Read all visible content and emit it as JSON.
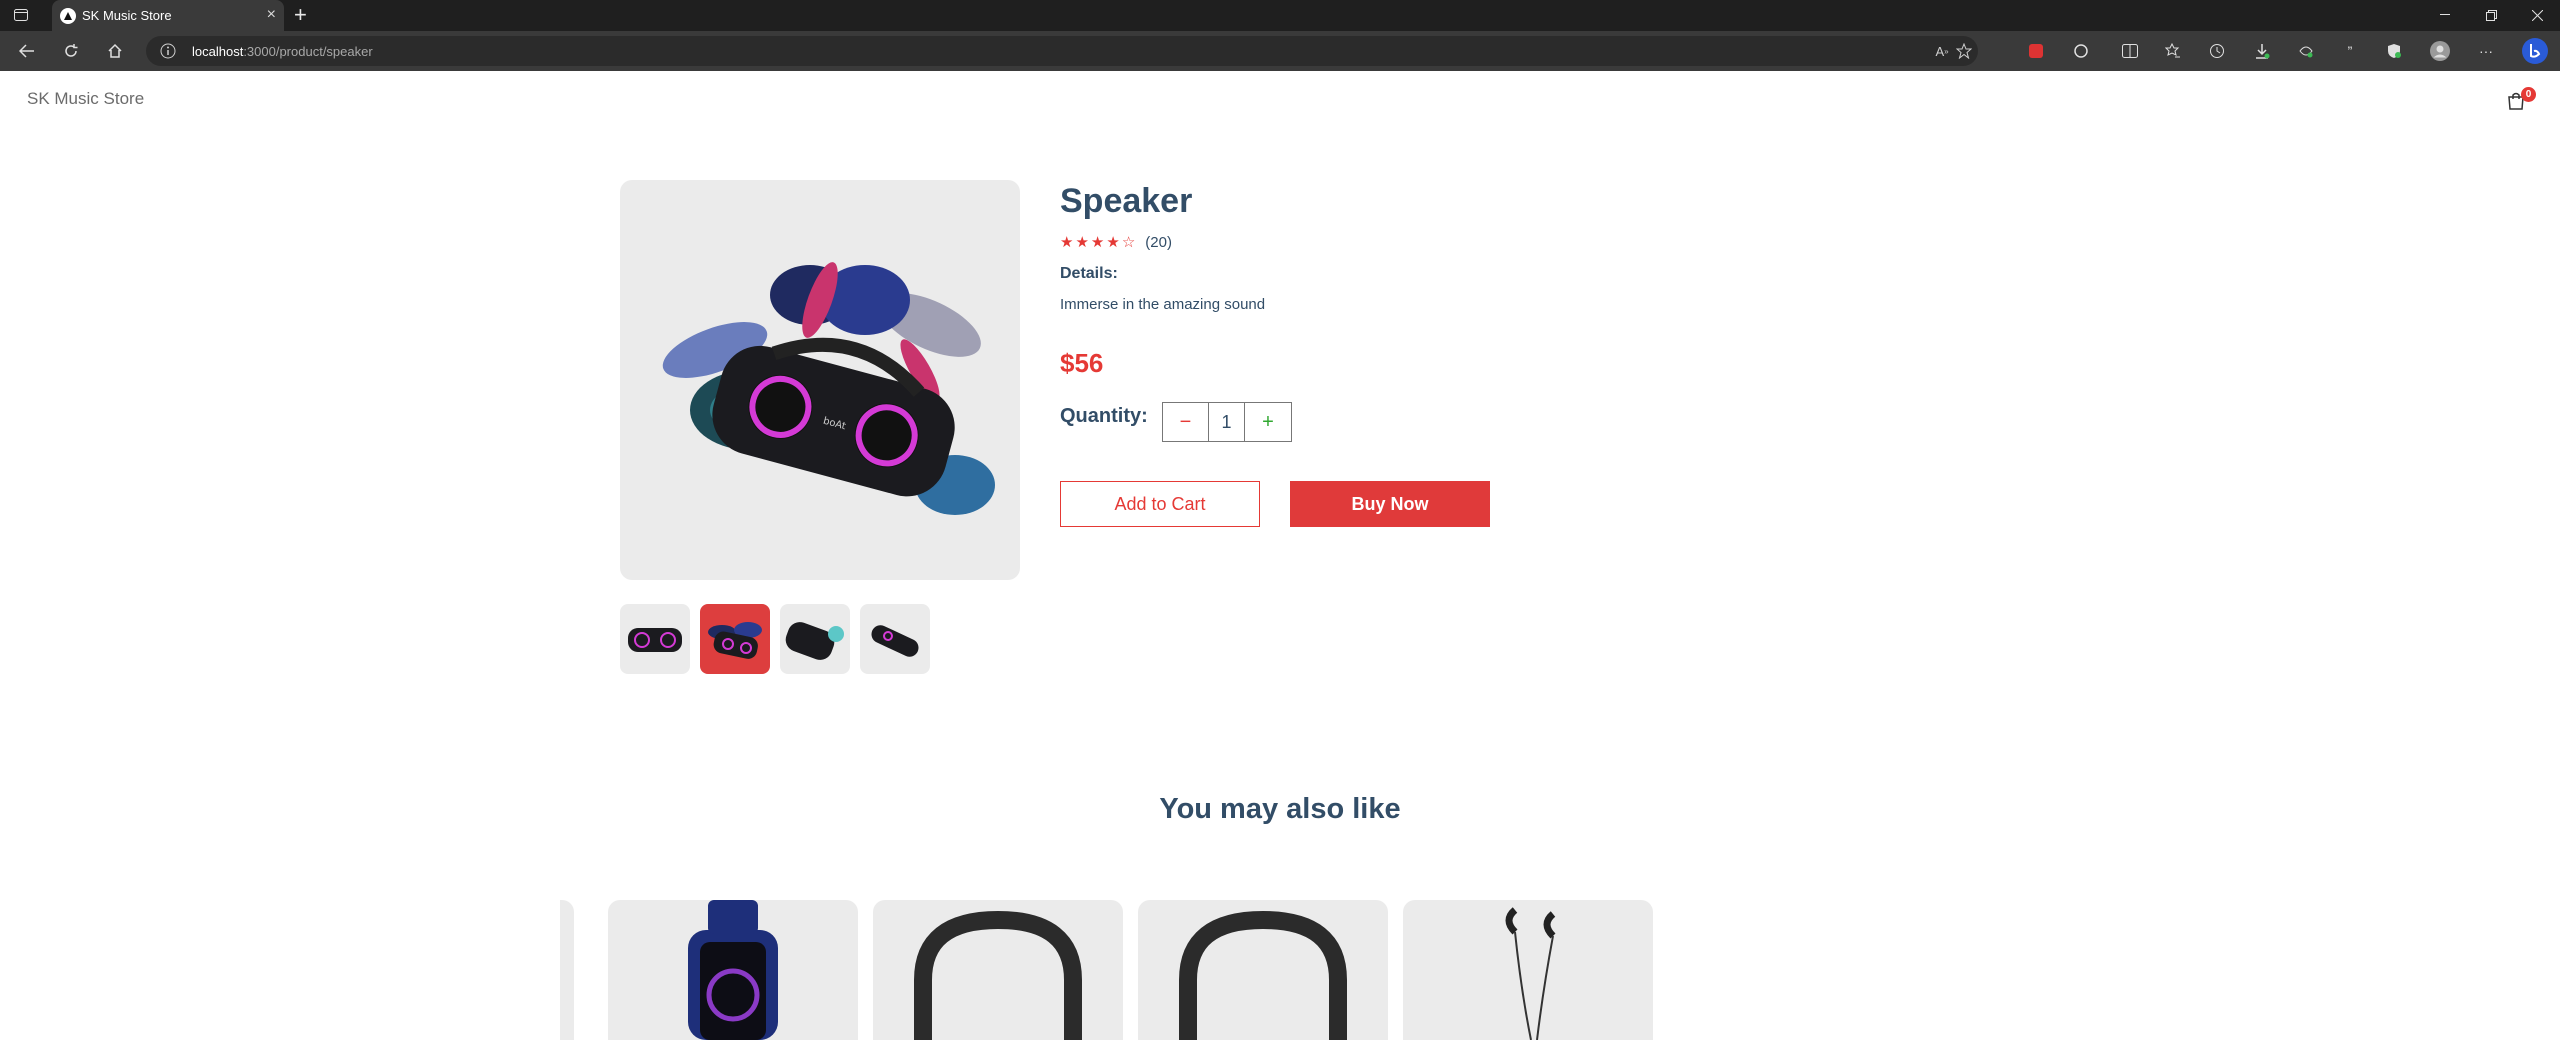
{
  "browser": {
    "tab_title": "SK Music Store",
    "new_tab": "+",
    "close_tab": "×",
    "url_host": "localhost",
    "url_path": ":3000/product/speaker"
  },
  "site": {
    "brand": "SK Music Store",
    "cart_count": "0"
  },
  "product": {
    "title": "Speaker",
    "rating": 4,
    "rating_max": 5,
    "rating_count": "(20)",
    "details_label": "Details:",
    "details_text": "Immerse in the amazing sound",
    "price": "$56",
    "quantity_label": "Quantity:",
    "quantity_minus": "−",
    "quantity_value": "1",
    "quantity_plus": "+",
    "add_to_cart_label": "Add to Cart",
    "buy_now_label": "Buy Now",
    "thumbnails": [
      "speaker-front",
      "speaker-plants",
      "speaker-side",
      "speaker-angle"
    ],
    "active_thumbnail": 1
  },
  "recommendations": {
    "heading": "You may also like",
    "items": [
      "smartwatch",
      "neckband-headphones",
      "neckband-headphones",
      "wired-earphones"
    ]
  },
  "colors": {
    "accent": "#e53935",
    "heading": "#324d67",
    "image_bg": "#ebebeb"
  }
}
